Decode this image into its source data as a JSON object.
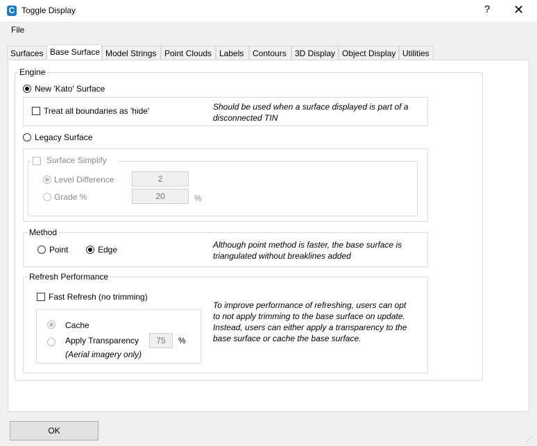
{
  "window": {
    "title": "Toggle Display",
    "help": "?",
    "close": "✕"
  },
  "menu": {
    "file": "File"
  },
  "tabs": [
    "Surfaces",
    "Base Surface",
    "Model Strings",
    "Point Clouds",
    "Labels",
    "Contours",
    "3D Display",
    "Object Display",
    "Utilities"
  ],
  "engine": {
    "legend": "Engine",
    "kato": "New 'Kato' Surface",
    "kato_selected": true,
    "hide_boundaries": "Treat all boundaries as 'hide'",
    "hide_note": "Should be used when a surface displayed is part of a disconnected TIN",
    "legacy": "Legacy Surface",
    "simplify": "Surface Simplify",
    "level_diff": "Level Difference",
    "level_value": "2",
    "grade": "Grade %",
    "grade_value": "20",
    "grade_unit": "%"
  },
  "method": {
    "legend": "Method",
    "point": "Point",
    "edge": "Edge",
    "edge_selected": true,
    "note": "Although point method is faster, the base surface is triangulated without breaklines added"
  },
  "refresh": {
    "legend": "Refresh Performance",
    "fast": "Fast Refresh (no trimming)",
    "cache": "Cache",
    "transparency": "Apply Transparency",
    "transparency_value": "75",
    "transparency_unit": "%",
    "aerial": "(Aerial imagery only)",
    "note": "To improve performance of refreshing, users can opt to not apply trimming to the base surface on update. Instead, users can either apply a transparency to the base surface or cache the base surface."
  },
  "footer": {
    "ok": "OK"
  }
}
